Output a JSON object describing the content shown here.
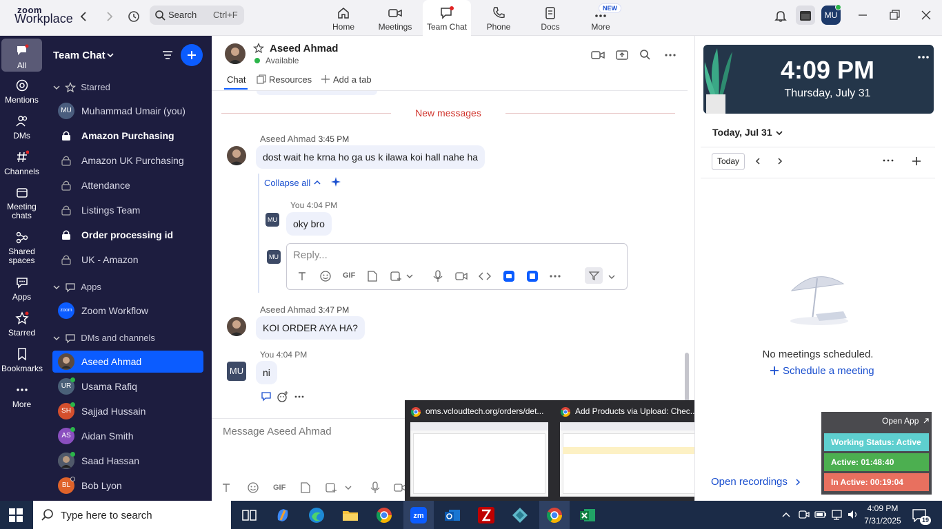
{
  "app": {
    "logo_line1": "zoom",
    "logo_line2": "Workplace",
    "search_label": "Search",
    "search_shortcut": "Ctrl+F",
    "user_initials": "MU"
  },
  "top_tabs": [
    {
      "label": "Home",
      "icon": "home-icon"
    },
    {
      "label": "Meetings",
      "icon": "video-icon"
    },
    {
      "label": "Team Chat",
      "icon": "chat-icon"
    },
    {
      "label": "Phone",
      "icon": "phone-icon"
    },
    {
      "label": "Docs",
      "icon": "docs-icon"
    },
    {
      "label": "More",
      "icon": "more-icon"
    }
  ],
  "new_badge": "NEW",
  "rail": [
    {
      "label": "All"
    },
    {
      "label": "Mentions"
    },
    {
      "label": "DMs"
    },
    {
      "label": "Channels"
    },
    {
      "label": "Meeting chats"
    },
    {
      "label": "Shared spaces"
    },
    {
      "label": "Apps"
    },
    {
      "label": "Starred"
    },
    {
      "label": "Bookmarks"
    },
    {
      "label": "More"
    }
  ],
  "side": {
    "title": "Team Chat",
    "starred_header": "Starred",
    "starred": [
      {
        "label": "Muhammad Umair (you)",
        "initials": "MU",
        "bold": false
      },
      {
        "label": "Amazon Purchasing",
        "bold": true
      },
      {
        "label": "Amazon UK Purchasing",
        "bold": false
      },
      {
        "label": "Attendance",
        "bold": false
      },
      {
        "label": "Listings Team",
        "bold": false
      },
      {
        "label": "Order processing id",
        "bold": true
      },
      {
        "label": "UK - Amazon",
        "bold": false
      }
    ],
    "apps_header": "Apps",
    "apps": [
      {
        "label": "Zoom Workflow",
        "initials": "zoom"
      }
    ],
    "dms_header": "DMs and channels",
    "dms": [
      {
        "label": "Aseed Ahmad",
        "initials": ""
      },
      {
        "label": "Usama Rafiq",
        "initials": "UR"
      },
      {
        "label": "Sajjad Hussain",
        "initials": "SH"
      },
      {
        "label": "Aidan Smith",
        "initials": "AS"
      },
      {
        "label": "Saad Hassan",
        "initials": ""
      },
      {
        "label": "Bob Lyon",
        "initials": "BL"
      }
    ]
  },
  "chat": {
    "contact_name": "Aseed Ahmad",
    "status": "Available",
    "tabs": [
      "Chat",
      "Resources",
      "Add a tab"
    ],
    "new_messages": "New messages",
    "messages": [
      {
        "sender": "Aseed Ahmad",
        "time": "3:45 PM",
        "text": "dost wait he krna ho ga us k ilawa koi hall nahe ha"
      },
      {
        "sender": "You",
        "time": "4:04 PM",
        "text": "oky bro",
        "initials": "MU"
      },
      {
        "sender": "Aseed Ahmad",
        "time": "3:47 PM",
        "text": "KOI ORDER AYA HA?"
      },
      {
        "sender": "You",
        "time": "4:04 PM",
        "text": "ni",
        "initials": "MU"
      }
    ],
    "collapse_all": "Collapse all",
    "reply_placeholder": "Reply...",
    "gif_label": "GIF",
    "message_placeholder": "Message Aseed Ahmad"
  },
  "right": {
    "clock_time": "4:09 PM",
    "clock_date": "Thursday, July 31",
    "today_header": "Today, Jul 31",
    "today_button": "Today",
    "no_meetings": "No meetings scheduled.",
    "schedule_link": "Schedule a meeting",
    "open_recordings": "Open recordings"
  },
  "previews": [
    {
      "title": "oms.vcloudtech.org/orders/det..."
    },
    {
      "title": "Add Products via Upload: Chec..."
    }
  ],
  "status_widget": {
    "open_app": "Open App",
    "working": "Working Status: Active",
    "active": "Active: 01:48:40",
    "inactive": "In Active: 00:19:04"
  },
  "taskbar": {
    "search_placeholder": "Type here to search",
    "time": "4:09 PM",
    "date": "7/31/2025",
    "notif_count": "19"
  },
  "colors": {
    "rail_bg": "#1d1d3f",
    "accent": "#0b5cff",
    "selected": "#0b5cff",
    "red": "#c8102e",
    "green_active": "#4caf50",
    "status_cyan": "#5ecfcf",
    "status_red": "#e8705f"
  }
}
